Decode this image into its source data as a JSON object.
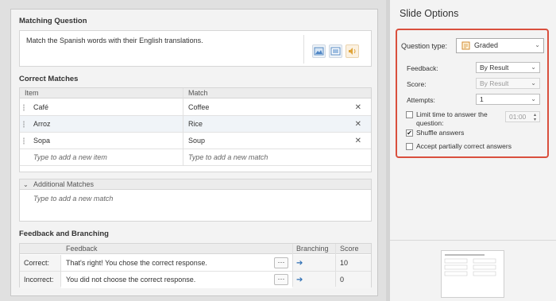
{
  "question": {
    "section_title": "Matching Question",
    "text": "Match the Spanish words with their English translations."
  },
  "correct_matches": {
    "section_title": "Correct Matches",
    "columns": [
      "Item",
      "Match"
    ],
    "rows": [
      {
        "item": "Café",
        "match": "Coffee"
      },
      {
        "item": "Arroz",
        "match": "Rice"
      },
      {
        "item": "Sopa",
        "match": "Soup"
      }
    ],
    "new_item_placeholder": "Type to add a new item",
    "new_match_placeholder": "Type to add a new match",
    "delete_glyph": "✕"
  },
  "additional_matches": {
    "title": "Additional Matches",
    "placeholder": "Type to add a new match"
  },
  "feedback_branching": {
    "section_title": "Feedback and Branching",
    "columns": [
      "Feedback",
      "Branching",
      "Score"
    ],
    "rows": [
      {
        "label": "Correct:",
        "feedback": "That's right! You chose the correct response.",
        "score": "10"
      },
      {
        "label": "Incorrect:",
        "feedback": "You did not choose the correct response.",
        "score": "0"
      }
    ],
    "ellipsis": "···",
    "arrow_glyph": "➔"
  },
  "slide_options": {
    "title": "Slide Options",
    "question_type_label": "Question type:",
    "question_type_value": "Graded",
    "feedback_label": "Feedback:",
    "feedback_value": "By Result",
    "score_label": "Score:",
    "score_value": "By Result",
    "attempts_label": "Attempts:",
    "attempts_value": "1",
    "limit_time_label_1": "Limit time to answer the",
    "limit_time_label_2": "question:",
    "limit_time_value": "01:00",
    "limit_time_checked": false,
    "shuffle_label": "Shuffle answers",
    "shuffle_checked": true,
    "partial_label": "Accept partially correct answers",
    "partial_checked": false,
    "check_glyph": "✔",
    "chevron_glyph": "⌄"
  },
  "colors": {
    "highlight_border": "#d94f3d",
    "arrow": "#2e6fb4",
    "alt_row": "#f0f4f8"
  }
}
